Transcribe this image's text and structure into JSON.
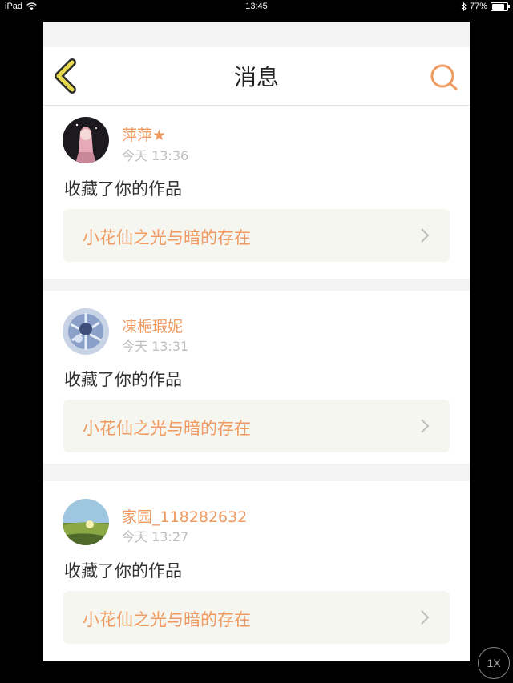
{
  "status_bar": {
    "device": "iPad",
    "time": "13:45",
    "battery": "77%",
    "battery_level": 0.77
  },
  "nav": {
    "title": "消息"
  },
  "colors": {
    "accent": "#ef9a60",
    "back_icon": "#e8d84c"
  },
  "notifications": [
    {
      "user": "萍萍★",
      "time": "今天 13:36",
      "message": "收藏了你的作品",
      "work_title": "小花仙之光与暗的存在"
    },
    {
      "user": "凍梔瑕妮",
      "time": "今天 13:31",
      "message": "收藏了你的作品",
      "work_title": "小花仙之光与暗的存在"
    },
    {
      "user": "家园_118282632",
      "time": "今天 13:27",
      "message": "收藏了你的作品",
      "work_title": "小花仙之光与暗的存在"
    }
  ],
  "zoom_badge": "1X"
}
